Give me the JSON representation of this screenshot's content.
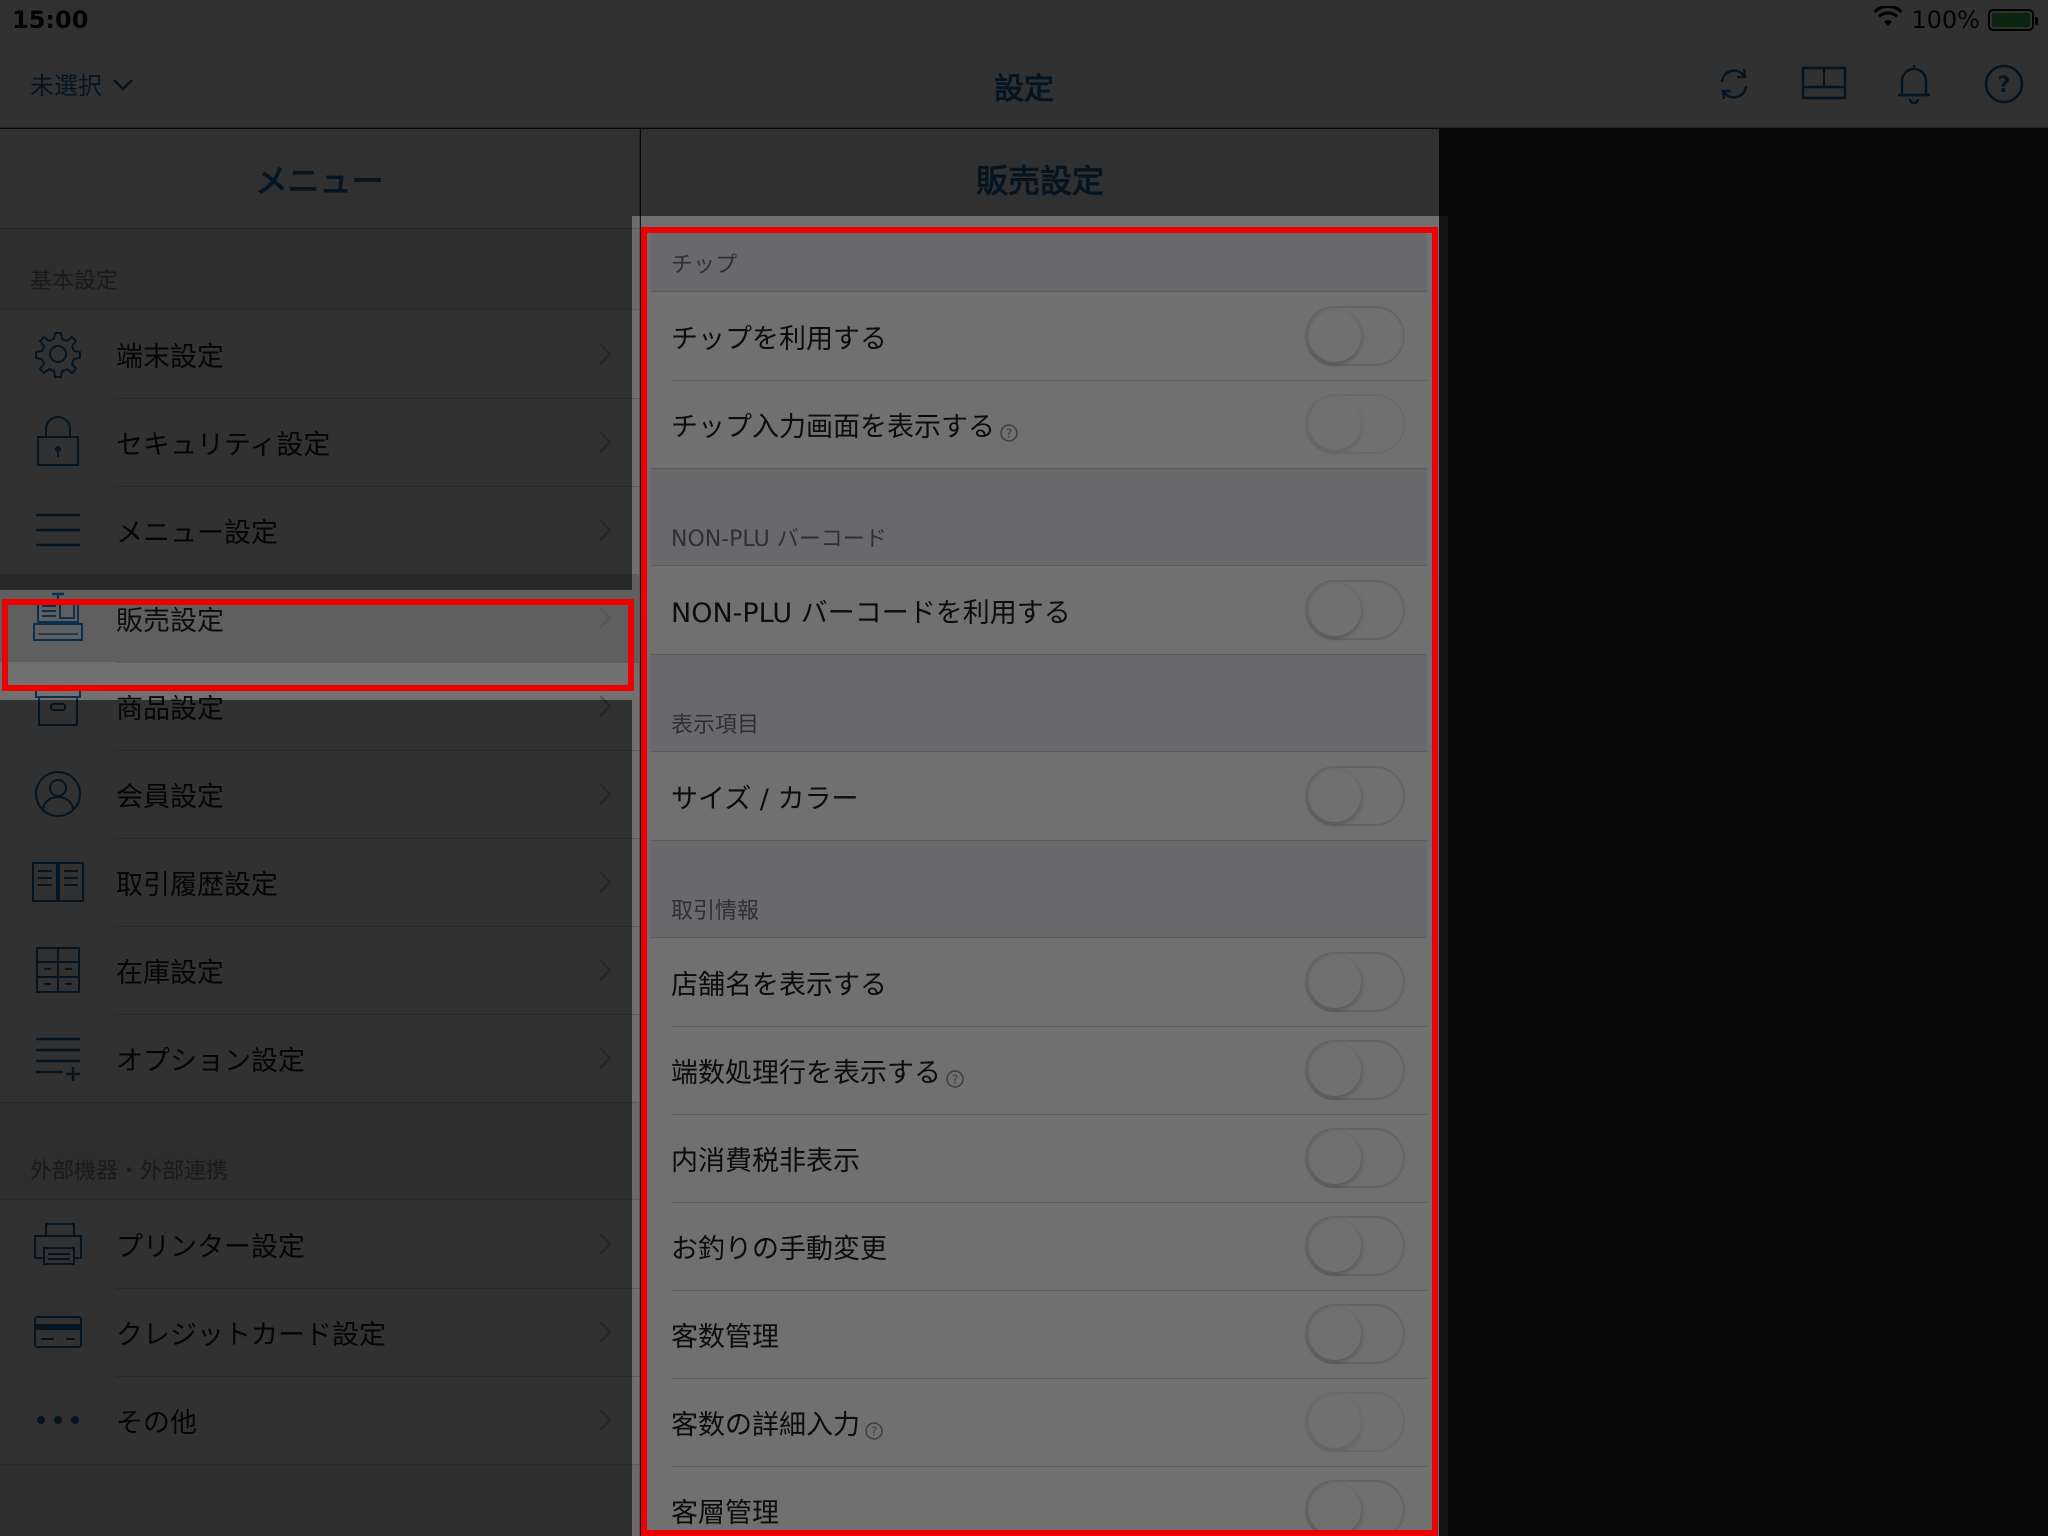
{
  "status": {
    "time": "15:00",
    "battery": "100%"
  },
  "nav": {
    "store_selector": "未選択",
    "title": "設定"
  },
  "left": {
    "header": "メニュー",
    "section1": "基本設定",
    "items1": [
      {
        "label": "端末設定",
        "icon": "gear-icon"
      },
      {
        "label": "セキュリティ設定",
        "icon": "lock-icon"
      },
      {
        "label": "メニュー設定",
        "icon": "menu-icon"
      },
      {
        "label": "販売設定",
        "icon": "register-icon"
      },
      {
        "label": "商品設定",
        "icon": "box-icon"
      },
      {
        "label": "会員設定",
        "icon": "person-icon"
      },
      {
        "label": "取引履歴設定",
        "icon": "book-icon"
      },
      {
        "label": "在庫設定",
        "icon": "shelf-icon"
      },
      {
        "label": "オプション設定",
        "icon": "list-plus-icon"
      }
    ],
    "section2": "外部機器・外部連携",
    "items2": [
      {
        "label": "プリンター設定",
        "icon": "printer-icon"
      },
      {
        "label": "クレジットカード設定",
        "icon": "credit-card-icon"
      },
      {
        "label": "その他",
        "icon": "more-icon"
      }
    ]
  },
  "right": {
    "header": "販売設定",
    "groups": [
      {
        "title": "チップ",
        "rows": [
          {
            "label": "チップを利用する",
            "on": false
          },
          {
            "label": "チップ入力画面を表示する",
            "on": false,
            "help": true,
            "disabled": true
          }
        ]
      },
      {
        "title": "NON-PLU バーコード",
        "rows": [
          {
            "label": "NON-PLU バーコードを利用する",
            "on": false
          }
        ]
      },
      {
        "title": "表示項目",
        "rows": [
          {
            "label": "サイズ / カラー",
            "on": false
          }
        ]
      },
      {
        "title": "取引情報",
        "rows": [
          {
            "label": "店舗名を表示する",
            "on": false
          },
          {
            "label": "端数処理行を表示する",
            "on": false,
            "help": true
          },
          {
            "label": "内消費税非表示",
            "on": false
          },
          {
            "label": "お釣りの手動変更",
            "on": false
          },
          {
            "label": "客数管理",
            "on": false
          },
          {
            "label": "客数の詳細入力",
            "on": false,
            "help": true,
            "disabled": true
          },
          {
            "label": "客層管理",
            "on": false
          }
        ]
      }
    ]
  },
  "colors": {
    "accent": "#1a6fb0",
    "highlight": "#ee0000"
  }
}
